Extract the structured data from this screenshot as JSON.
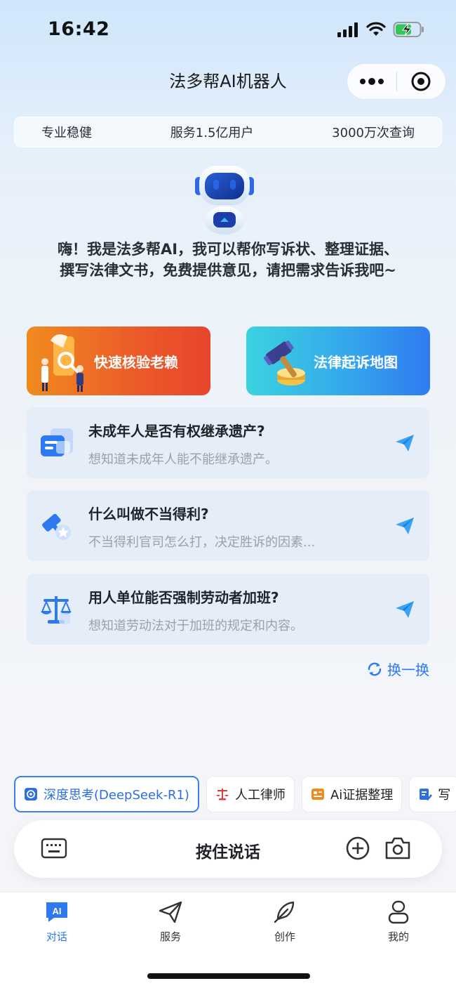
{
  "status_bar": {
    "time": "16:42"
  },
  "header": {
    "title": "法多帮AI机器人"
  },
  "stats": [
    "专业稳健",
    "服务1.5亿用户",
    "3000万次查询"
  ],
  "greeting": {
    "line1": "嗨！我是法多帮AI，我可以帮你写诉状、整理证据、",
    "line2": "撰写法律文书，免费提供意见，请把需求告诉我吧~"
  },
  "features": [
    {
      "label": "快速核验老赖",
      "icon": "magnifier-phone-icon"
    },
    {
      "label": "法律起诉地图",
      "icon": "gavel-icon"
    }
  ],
  "questions": [
    {
      "title": "未成年人是否有权继承遗产?",
      "subtitle": "想知道未成年人能不能继承遗产。",
      "icon": "document-card-icon"
    },
    {
      "title": "什么叫做不当得利?",
      "subtitle": "不当得利官司怎么打，决定胜诉的因素...",
      "icon": "gavel-star-icon"
    },
    {
      "title": "用人单位能否强制劳动者加班?",
      "subtitle": "想知道劳动法对于加班的规定和内容。",
      "icon": "scales-icon"
    }
  ],
  "refresh_label": "换一换",
  "chips": [
    {
      "label": "深度思考(DeepSeek-R1)",
      "icon": "deepseek-icon"
    },
    {
      "label": "人工律师",
      "icon": "scales-icon"
    },
    {
      "label": "Ai证据整理",
      "icon": "evidence-icon"
    },
    {
      "label": "写",
      "icon": "write-icon"
    }
  ],
  "input": {
    "hold_to_talk": "按住说话"
  },
  "tabs": [
    {
      "label": "对话",
      "icon": "ai-chat-icon"
    },
    {
      "label": "服务",
      "icon": "paper-plane-icon"
    },
    {
      "label": "创作",
      "icon": "feather-icon"
    },
    {
      "label": "我的",
      "icon": "user-icon"
    }
  ],
  "colors": {
    "accent": "#2d7af0",
    "orange": "#ec5a2a",
    "card_bg": "#e5edf9"
  }
}
